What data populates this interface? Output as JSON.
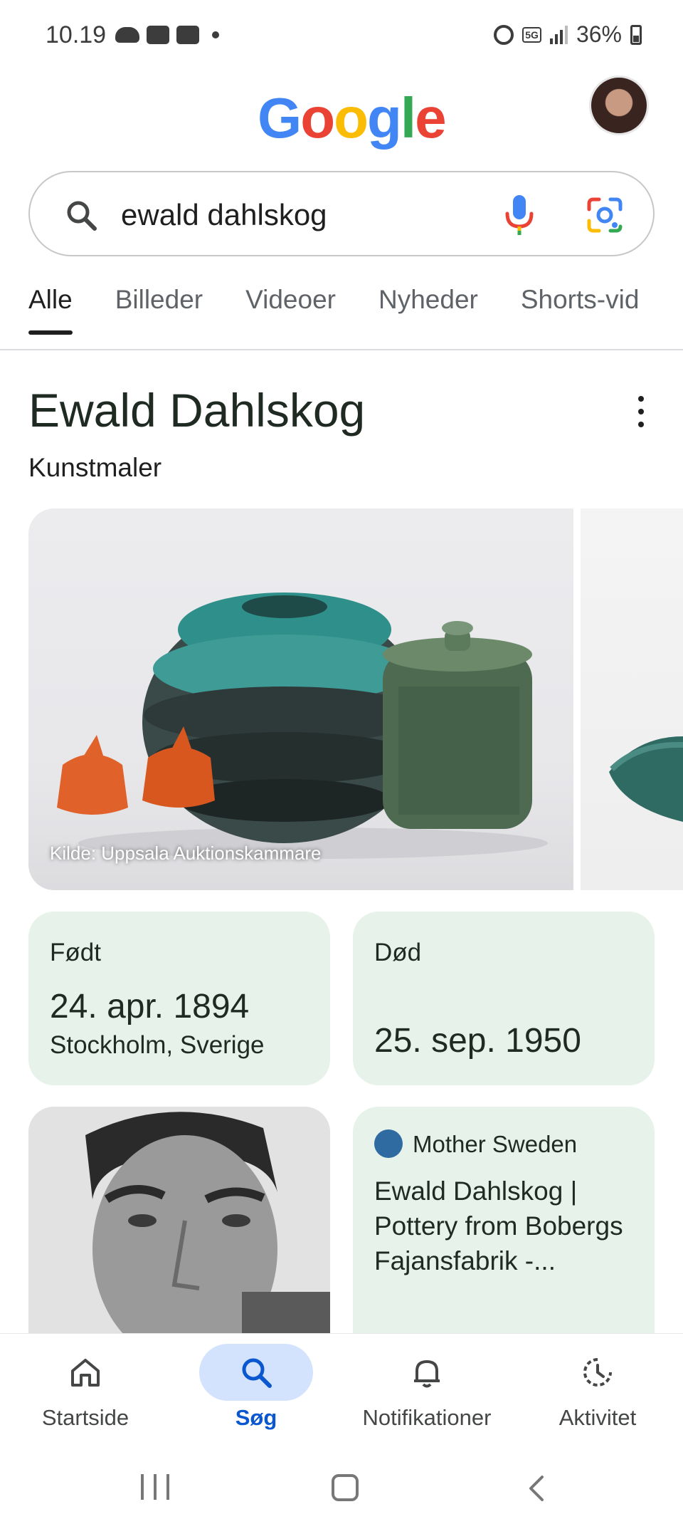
{
  "status_bar": {
    "time": "10.19",
    "network": "5G",
    "battery": "36%"
  },
  "header": {
    "logo_letters": [
      "G",
      "o",
      "o",
      "g",
      "l",
      "e"
    ],
    "logo_colors": [
      "#4285F4",
      "#EA4335",
      "#FBBC05",
      "#4285F4",
      "#34A853",
      "#EA4335"
    ]
  },
  "search": {
    "query": "ewald dahlskog",
    "icons": [
      "search-icon",
      "mic-icon",
      "lens-icon"
    ]
  },
  "tabs": [
    {
      "label": "Alle",
      "active": true
    },
    {
      "label": "Billeder"
    },
    {
      "label": "Videoer"
    },
    {
      "label": "Nyheder"
    },
    {
      "label": "Shorts-vid"
    }
  ],
  "knowledge_panel": {
    "title": "Ewald Dahlskog",
    "subtitle": "Kunstmaler",
    "image_caption": "Kilde: Uppsala Auktionskammare",
    "born": {
      "label": "Født",
      "date": "24. apr. 1894",
      "place": "Stockholm, Sverige"
    },
    "died": {
      "label": "Død",
      "date": "25. sep. 1950"
    },
    "article": {
      "site": "Mother Sweden",
      "title": "Ewald Dahlskog | Pottery from Bobergs Fajansfabrik -..."
    }
  },
  "bottom_nav": [
    {
      "label": "Startside",
      "icon": "home-icon"
    },
    {
      "label": "Søg",
      "icon": "search-icon",
      "active": true
    },
    {
      "label": "Notifikationer",
      "icon": "bell-icon"
    },
    {
      "label": "Aktivitet",
      "icon": "activity-icon"
    }
  ],
  "colors": {
    "accent": "#0b57d0",
    "card_bg": "#e6f2ea",
    "nav_active_bg": "#d3e3fd"
  }
}
